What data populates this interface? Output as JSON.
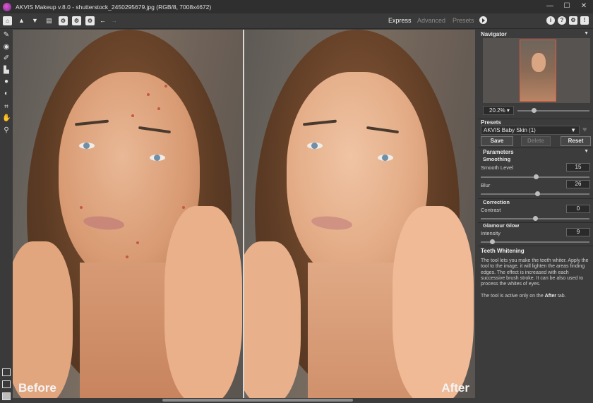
{
  "window": {
    "title": "AKVIS Makeup v.8.0 - shutterstock_2450295679.jpg (RGB/8, 7008x4672)",
    "controls": [
      "—",
      "☐",
      "✕"
    ]
  },
  "toolbar": {
    "modes": [
      "Express",
      "Advanced",
      "Presets"
    ],
    "active_mode": "Express"
  },
  "image": {
    "before_label": "Before",
    "after_label": "After"
  },
  "navigator": {
    "title": "Navigator",
    "zoom": "20.2%",
    "zoom_level": 0.2
  },
  "presets": {
    "title": "Presets",
    "selected": "AKVIS Baby Skin (1)",
    "buttons": {
      "save": "Save",
      "delete": "Delete",
      "reset": "Reset"
    }
  },
  "parameters": {
    "title": "Parameters",
    "smoothing": {
      "group": "Smoothing",
      "smooth_level": {
        "label": "Smooth Level",
        "value": "15"
      },
      "blur": {
        "label": "Blur",
        "value": "26"
      }
    },
    "correction": {
      "group": "Correction",
      "contrast": {
        "label": "Contrast",
        "value": "0"
      }
    },
    "glamour_glow": {
      "group": "Glamour Glow",
      "intensity": {
        "label": "Intensity",
        "value": "9"
      }
    }
  },
  "help": {
    "title": "Teeth Whitening",
    "paragraph1": "The tool lets you make the teeth whiter. Apply the tool to the image, it will lighten the areas finding edges. The effect is increased with each successive brush stroke. It can be also used to process the whites of eyes.",
    "paragraph2_prefix": "The tool is active only on the ",
    "paragraph2_bold": "After",
    "paragraph2_suffix": " tab."
  },
  "colors": {
    "accent_navigator_frame": "#e85a3a",
    "panel_bg": "#3c3c3c",
    "toolbar_bg": "#3a3a3a"
  }
}
